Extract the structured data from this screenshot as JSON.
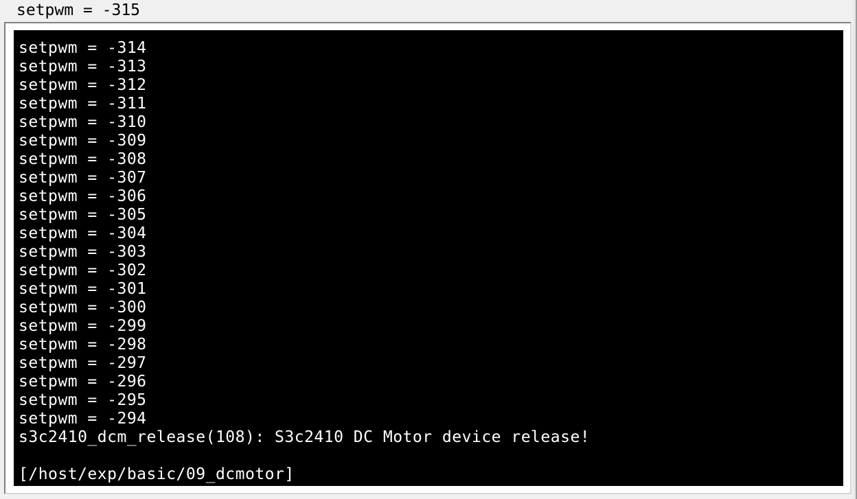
{
  "top": {
    "text": "setpwm = -315"
  },
  "terminal": {
    "lines": [
      "setpwm = -314",
      "setpwm = -313",
      "setpwm = -312",
      "setpwm = -311",
      "setpwm = -310",
      "setpwm = -309",
      "setpwm = -308",
      "setpwm = -307",
      "setpwm = -306",
      "setpwm = -305",
      "setpwm = -304",
      "setpwm = -303",
      "setpwm = -302",
      "setpwm = -301",
      "setpwm = -300",
      "setpwm = -299",
      "setpwm = -298",
      "setpwm = -297",
      "setpwm = -296",
      "setpwm = -295",
      "setpwm = -294",
      "s3c2410_dcm_release(108): S3c2410 DC Motor device release!",
      "",
      "[/host/exp/basic/09_dcmotor]"
    ]
  }
}
